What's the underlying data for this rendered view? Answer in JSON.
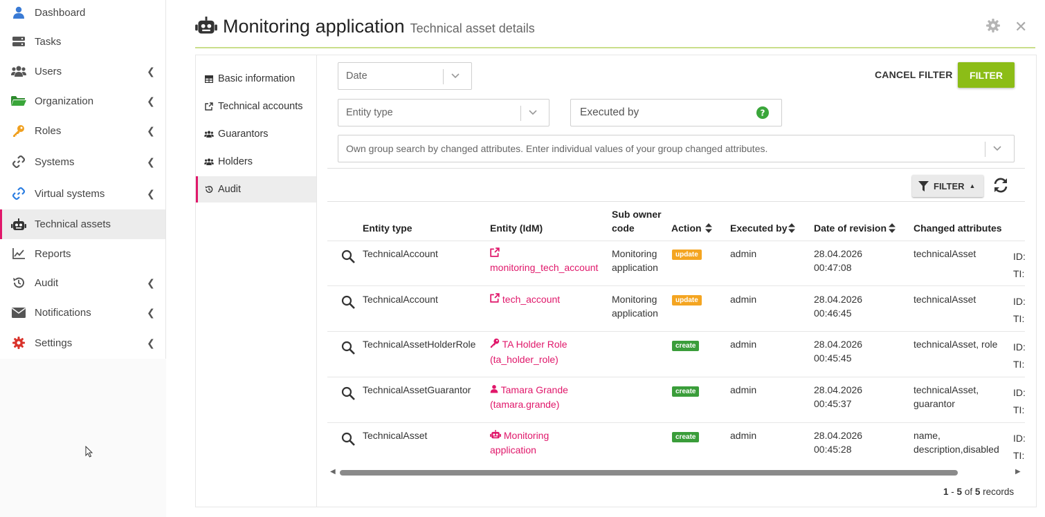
{
  "sidebar": {
    "items": [
      {
        "label": "Dashboard",
        "icon": "user-icon",
        "chevron": false
      },
      {
        "label": "Tasks",
        "icon": "tasks-icon",
        "chevron": false
      },
      {
        "label": "Users",
        "icon": "users-icon",
        "chevron": true
      },
      {
        "label": "Organization",
        "icon": "folder-open-icon",
        "chevron": true
      },
      {
        "label": "Roles",
        "icon": "key-icon",
        "chevron": true
      },
      {
        "label": "Systems",
        "icon": "link-icon",
        "chevron": true
      },
      {
        "label": "Virtual systems",
        "icon": "link-blue-icon",
        "chevron": true
      },
      {
        "label": "Technical assets",
        "icon": "robot-icon",
        "chevron": false,
        "active": true
      },
      {
        "label": "Reports",
        "icon": "chart-line-icon",
        "chevron": false
      },
      {
        "label": "Audit",
        "icon": "history-icon",
        "chevron": true
      },
      {
        "label": "Notifications",
        "icon": "envelope-icon",
        "chevron": true
      },
      {
        "label": "Settings",
        "icon": "cog-icon",
        "chevron": true
      }
    ]
  },
  "header": {
    "title": "Monitoring application",
    "subtitle": "Technical asset details",
    "close_glyph": "✕"
  },
  "tabs": [
    {
      "label": "Basic information",
      "icon": "table-icon"
    },
    {
      "label": "Technical accounts",
      "icon": "external-link-icon"
    },
    {
      "label": "Guarantors",
      "icon": "users-icon"
    },
    {
      "label": "Holders",
      "icon": "users-icon"
    },
    {
      "label": "Audit",
      "icon": "history-icon",
      "active": true
    }
  ],
  "filters": {
    "date_placeholder": "Date",
    "entity_type_placeholder": "Entity type",
    "executed_by_placeholder": "Executed by",
    "changed_attrs_placeholder": "Own group search by changed attributes. Enter individual values of your group changed attributes.",
    "cancel_label": "CANCEL FILTER",
    "filter_label": "FILTER",
    "toggle_label": "FILTER"
  },
  "table": {
    "headers": {
      "entity_type": "Entity type",
      "entity_idm": "Entity (IdM)",
      "sub_owner_line1": "Sub owner",
      "sub_owner_line2": "code",
      "action": "Action",
      "executed_by": "Executed by",
      "date": "Date of revision",
      "changed": "Changed attributes"
    },
    "rows": [
      {
        "entity_type": "TechnicalAccount",
        "entity_icon": "external-link-icon",
        "entity_line1": "",
        "entity_line2": "monitoring_tech_account",
        "sub_owner_line1": "Monitoring",
        "sub_owner_line2": "application",
        "action": "update",
        "executed_by": "admin",
        "date_line1": "28.04.2026",
        "date_line2": "00:47:08",
        "changed_line1": "technicalAsset",
        "changed_line2": "",
        "extra_line1": "ID:",
        "extra_line2": "TI:"
      },
      {
        "entity_type": "TechnicalAccount",
        "entity_icon": "external-link-icon",
        "entity_line1": "tech_account",
        "entity_line2": "",
        "sub_owner_line1": "Monitoring",
        "sub_owner_line2": "application",
        "action": "update",
        "executed_by": "admin",
        "date_line1": "28.04.2026",
        "date_line2": "00:46:45",
        "changed_line1": "technicalAsset",
        "changed_line2": "",
        "extra_line1": "ID:",
        "extra_line2": "TI:"
      },
      {
        "entity_type": "TechnicalAssetHolderRole",
        "entity_icon": "key-icon",
        "entity_line1": "TA Holder Role",
        "entity_line2": "(ta_holder_role)",
        "sub_owner_line1": "",
        "sub_owner_line2": "",
        "action": "create",
        "executed_by": "admin",
        "date_line1": "28.04.2026",
        "date_line2": "00:45:45",
        "changed_line1": "technicalAsset, role",
        "changed_line2": "",
        "extra_line1": "ID:",
        "extra_line2": "TI:"
      },
      {
        "entity_type": "TechnicalAssetGuarantor",
        "entity_icon": "user-icon",
        "entity_line1": "Tamara Grande",
        "entity_line2": "(tamara.grande)",
        "sub_owner_line1": "",
        "sub_owner_line2": "",
        "action": "create",
        "executed_by": "admin",
        "date_line1": "28.04.2026",
        "date_line2": "00:45:37",
        "changed_line1": "technicalAsset,",
        "changed_line2": "guarantor",
        "extra_line1": "ID:",
        "extra_line2": "TI:"
      },
      {
        "entity_type": "TechnicalAsset",
        "entity_icon": "robot-icon",
        "entity_line1": "Monitoring",
        "entity_line2": "application",
        "sub_owner_line1": "",
        "sub_owner_line2": "",
        "action": "create",
        "executed_by": "admin",
        "date_line1": "28.04.2026",
        "date_line2": "00:45:28",
        "changed_line1": "name,",
        "changed_line2": "description,disabled",
        "extra_line1": "ID:",
        "extra_line2": "TI:"
      }
    ]
  },
  "pagination": {
    "from": "1",
    "to": "5",
    "of_word": "of",
    "total": "5",
    "records_word": "records",
    "dash": "-"
  },
  "colors": {
    "accent": "#e0176a",
    "primary": "#8cbd17",
    "update": "#f4a521",
    "create": "#3a9d3a"
  }
}
